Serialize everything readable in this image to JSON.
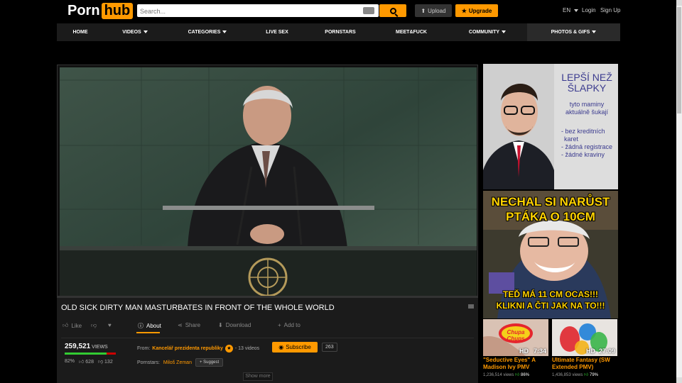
{
  "header": {
    "logo": {
      "part1": "Porn",
      "part2": "hub"
    },
    "search_placeholder": "Search...",
    "upload_label": "Upload",
    "upgrade_label": "Upgrade",
    "language": "EN",
    "login": "Login",
    "signup": "Sign Up"
  },
  "nav": {
    "items": [
      {
        "label": "HOME"
      },
      {
        "label": "VIDEOS"
      },
      {
        "label": "CATEGORIES"
      },
      {
        "label": "LIVE SEX"
      },
      {
        "label": "PORNSTARS"
      },
      {
        "label": "MEET&FUCK"
      },
      {
        "label": "COMMUNITY"
      },
      {
        "label": "PHOTOS & GIFS"
      }
    ]
  },
  "video": {
    "title": "OLD SICK DIRTY MAN MASTURBATES IN FRONT OF THE WHOLE WORLD",
    "actions": {
      "like": "Like",
      "about": "About",
      "share": "Share",
      "download": "Download",
      "add_to": "Add to"
    },
    "views": "259,521",
    "views_label": "VIEWS",
    "rating_percent": "82%",
    "rating_fraction": 0.82,
    "likes": "628",
    "dislikes": "132",
    "from_label": "From:",
    "channel": "Kancelář prezidenta republiky",
    "video_count": "- 13 videos",
    "subscribe_label": "Subscribe",
    "subscriber_count": "263",
    "pornstars_label": "Pornstars:",
    "pornstar": "Miloš Zeman",
    "suggest_label": "Suggest",
    "show_more": "Show more"
  },
  "ads": {
    "ad1": {
      "headline1": "LEPŠÍ NEŽ",
      "headline2": "ŠLAPKY",
      "sub1": "tyto maminy",
      "sub2": "aktuálně šukají",
      "bullets": [
        "- bez kreditních",
        "karet",
        "- žádná registrace",
        "- žádné kraviny"
      ]
    },
    "ad2": {
      "top1": "NECHAL SI NARŮST",
      "top2": "PTÁKA O 10CM",
      "bottom1": "TEĎ MÁ 11 CM OCAS!!!",
      "bottom2": "KLIKNI A ČTI JAK NA TO!!!"
    }
  },
  "related": [
    {
      "thumb_text": "Chupa Chups",
      "quality": "HD",
      "duration": "7:34",
      "title_line1": "\"Seductive Eyes\" A",
      "title_line2": "Madison Ivy PMV",
      "views": "1,236,514 views",
      "rating": "86%"
    },
    {
      "quality": "HD",
      "duration": "27:09",
      "title_line1": "Ultimate Fantasy (SW",
      "title_line2": "Extended PMV)",
      "views": "1,436,853 views",
      "rating": "79%"
    }
  ],
  "colors": {
    "accent": "#ff9900",
    "background": "#000000",
    "panel": "#1b1b1b"
  }
}
